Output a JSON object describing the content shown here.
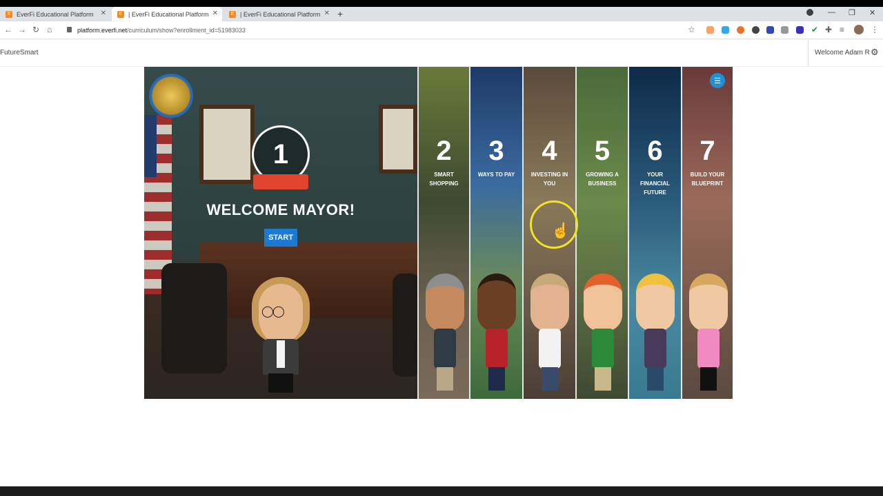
{
  "browser": {
    "tabs": [
      {
        "favicon": "E",
        "title": "EverFi Educational Platform"
      },
      {
        "favicon": "E",
        "title": "| EverFi Educational Platform"
      },
      {
        "favicon": "E",
        "title": "| EverFi Educational Platform"
      }
    ],
    "url_domain": "platform.everfi.net",
    "url_path": "/curriculum/show?enrollment_id=51983033"
  },
  "site": {
    "logo_alt": "FutureSmart",
    "welcome_text": "Welcome Adam R"
  },
  "course": {
    "current_level": "1",
    "welcome_title": "WELCOME MAYOR!",
    "start_label": "START",
    "modules": [
      {
        "number": "2",
        "title": "SMART SHOPPING"
      },
      {
        "number": "3",
        "title": "WAYS TO PAY"
      },
      {
        "number": "4",
        "title": "INVESTING IN YOU"
      },
      {
        "number": "5",
        "title": "GROWING A BUSINESS"
      },
      {
        "number": "6",
        "title": "YOUR FINANCIAL FUTURE"
      },
      {
        "number": "7",
        "title": "BUILD YOUR BLUEPRINT"
      }
    ]
  },
  "colors": {
    "start_button": "#1c7ad3",
    "ribbon": "#e0452e",
    "cursor_highlight": "#f1e326"
  }
}
